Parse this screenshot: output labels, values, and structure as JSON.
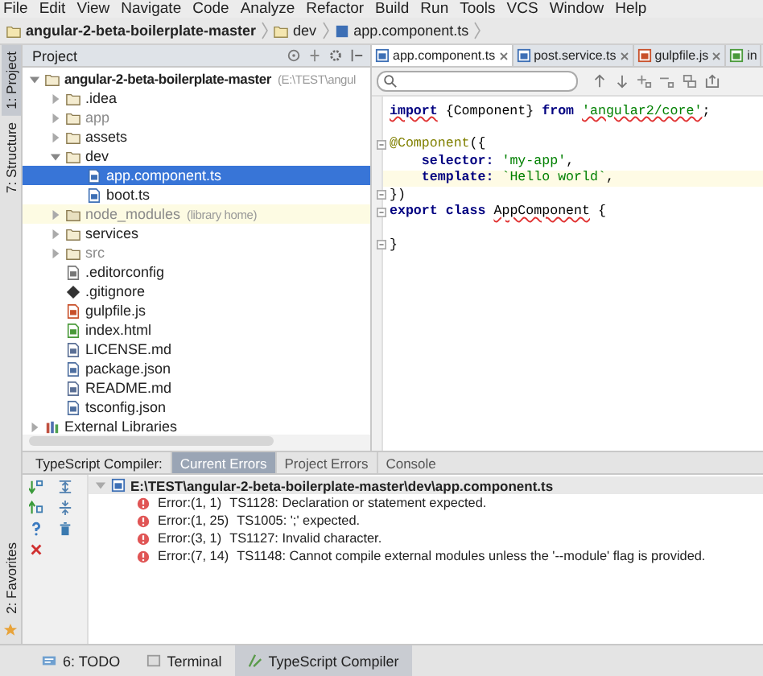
{
  "menu": [
    "File",
    "Edit",
    "View",
    "Navigate",
    "Code",
    "Analyze",
    "Refactor",
    "Build",
    "Run",
    "Tools",
    "VCS",
    "Window",
    "Help"
  ],
  "breadcrumb": [
    {
      "label": "angular-2-beta-boilerplate-master",
      "kind": "project"
    },
    {
      "label": "dev",
      "kind": "folder"
    },
    {
      "label": "app.component.ts",
      "kind": "ts"
    }
  ],
  "tool_windows_left": [
    {
      "label": "1: Project",
      "selected": true
    },
    {
      "label": "7: Structure",
      "selected": false
    },
    {
      "label": "2: Favorites",
      "selected": false
    }
  ],
  "project_panel": {
    "title": "Project",
    "tree": [
      {
        "label": "angular-2-beta-boilerplate-master",
        "note": "(E:\\TEST\\angul",
        "kind": "root",
        "expanded": true,
        "selected": false,
        "children": [
          {
            "label": ".idea",
            "kind": "folder",
            "expanded": false,
            "selected": false
          },
          {
            "label": "app",
            "kind": "excluded",
            "expanded": false,
            "selected": false
          },
          {
            "label": "assets",
            "kind": "folder",
            "expanded": false,
            "selected": false
          },
          {
            "label": "dev",
            "kind": "folder",
            "expanded": true,
            "selected": false,
            "children": [
              {
                "label": "app.component.ts",
                "kind": "ts",
                "selected": true
              },
              {
                "label": "boot.ts",
                "kind": "ts",
                "selected": false
              }
            ]
          },
          {
            "label": "node_modules",
            "note": "(library home)",
            "kind": "library",
            "expanded": false,
            "selected": false
          },
          {
            "label": "services",
            "kind": "folder",
            "expanded": false,
            "selected": false
          },
          {
            "label": "src",
            "kind": "excluded",
            "expanded": false,
            "selected": false
          },
          {
            "label": ".editorconfig",
            "kind": "config",
            "selected": false
          },
          {
            "label": ".gitignore",
            "kind": "git",
            "selected": false
          },
          {
            "label": "gulpfile.js",
            "kind": "js",
            "selected": false
          },
          {
            "label": "index.html",
            "kind": "html",
            "selected": false
          },
          {
            "label": "LICENSE.md",
            "kind": "md",
            "selected": false
          },
          {
            "label": "package.json",
            "kind": "json",
            "selected": false
          },
          {
            "label": "README.md",
            "kind": "md",
            "selected": false
          },
          {
            "label": "tsconfig.json",
            "kind": "json",
            "selected": false
          }
        ]
      },
      {
        "label": "External Libraries",
        "kind": "libraries",
        "expanded": false,
        "selected": false
      }
    ]
  },
  "editor_tabs": [
    {
      "label": "app.component.ts",
      "kind": "ts",
      "selected": true
    },
    {
      "label": "post.service.ts",
      "kind": "ts",
      "selected": false
    },
    {
      "label": "gulpfile.js",
      "kind": "js",
      "selected": false
    },
    {
      "label": "in",
      "kind": "html",
      "selected": false
    }
  ],
  "code": [
    {
      "fold": false,
      "current": false,
      "tokens": [
        {
          "text": "import",
          "kind": "kw",
          "squiggle": true
        },
        {
          "text": " {Component} ",
          "kind": "plain",
          "squiggle": false
        },
        {
          "text": "from ",
          "kind": "kw",
          "squiggle": false
        },
        {
          "text": "'angular2/core'",
          "kind": "str",
          "squiggle": true
        },
        {
          "text": ";",
          "kind": "plain",
          "squiggle": false
        }
      ]
    },
    {
      "fold": false,
      "current": false
    },
    {
      "fold": true,
      "current": false,
      "tokens": [
        {
          "text": "@Component",
          "kind": "ann",
          "squiggle": false
        },
        {
          "text": "({",
          "kind": "plain",
          "squiggle": false
        }
      ]
    },
    {
      "fold": false,
      "current": false,
      "tokens": [
        {
          "text": "    selector: ",
          "kind": "kw",
          "squiggle": false
        },
        {
          "text": "'my-app'",
          "kind": "str",
          "squiggle": false
        },
        {
          "text": ",",
          "kind": "plain",
          "squiggle": false
        }
      ]
    },
    {
      "fold": false,
      "current": true,
      "tokens": [
        {
          "text": "    template: ",
          "kind": "kw",
          "squiggle": false
        },
        {
          "text": "`Hello world`",
          "kind": "str",
          "squiggle": false
        },
        {
          "text": ",",
          "kind": "plain",
          "squiggle": false
        }
      ]
    },
    {
      "fold": true,
      "current": false,
      "tokens": [
        {
          "text": "})",
          "kind": "plain",
          "squiggle": false
        }
      ]
    },
    {
      "fold": true,
      "current": false,
      "tokens": [
        {
          "text": "export class ",
          "kind": "kw",
          "squiggle": false
        },
        {
          "text": "AppComponent",
          "kind": "plain",
          "squiggle": true
        },
        {
          "text": " {",
          "kind": "plain",
          "squiggle": false
        }
      ]
    },
    {
      "fold": false,
      "current": false
    },
    {
      "fold": true,
      "current": false,
      "tokens": [
        {
          "text": "}",
          "kind": "plain",
          "squiggle": false
        }
      ]
    }
  ],
  "bottom_panel": {
    "title": "TypeScript Compiler:",
    "tabs": [
      {
        "label": "Current Errors",
        "selected": true
      },
      {
        "label": "Project Errors",
        "selected": false
      },
      {
        "label": "Console",
        "selected": false
      }
    ],
    "file": "E:\\TEST\\angular-2-beta-boilerplate-master\\dev\\app.component.ts",
    "errors": [
      {
        "location": "Error:(1, 1)",
        "message": "TS1128: Declaration or statement expected."
      },
      {
        "location": "Error:(1, 25)",
        "message": "TS1005: ';' expected."
      },
      {
        "location": "Error:(3, 1)",
        "message": "TS1127: Invalid character."
      },
      {
        "location": "Error:(7, 14)",
        "message": "TS1148: Cannot compile external modules unless the '--module' flag is provided."
      }
    ]
  },
  "bottom_tabs": [
    {
      "label": "6: TODO",
      "selected": false
    },
    {
      "label": "Terminal",
      "selected": false
    },
    {
      "label": "TypeScript Compiler",
      "selected": true
    }
  ]
}
